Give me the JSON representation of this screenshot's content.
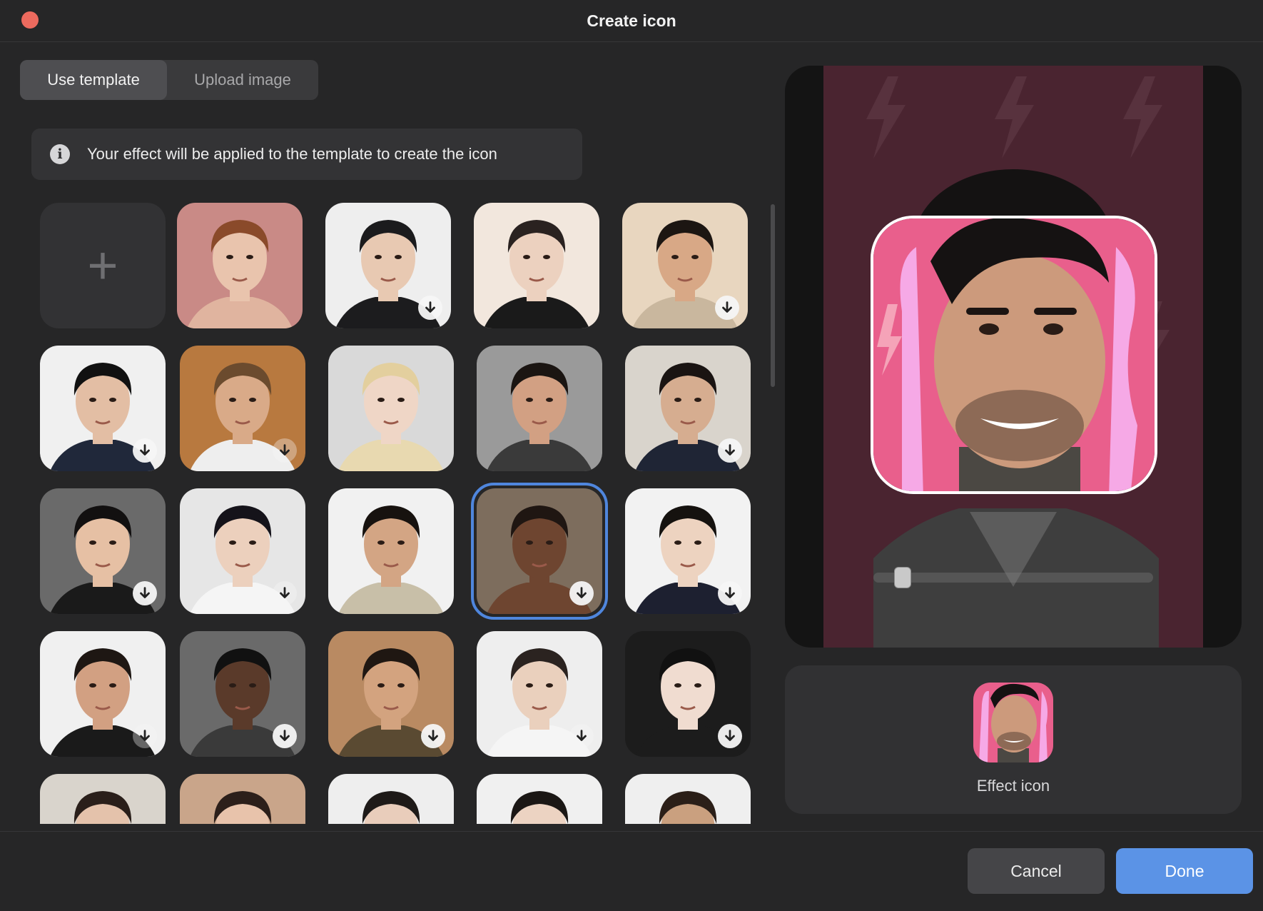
{
  "window": {
    "title": "Create icon"
  },
  "tabs": [
    {
      "label": "Use template",
      "active": true
    },
    {
      "label": "Upload image",
      "active": false
    }
  ],
  "info": {
    "text": "Your effect will be applied to the template to create the icon"
  },
  "templates": {
    "add_label": "+",
    "selected_index": 12,
    "items": [
      {
        "skin": "#e9c4ad",
        "hair": "#8a4a2a",
        "bg": "#c98a86",
        "shirt": "#e0b49f",
        "download": "none"
      },
      {
        "skin": "#e8c9b2",
        "hair": "#1b1b1d",
        "bg": "#eeeeee",
        "shirt": "#1c1c1e",
        "download": "solid"
      },
      {
        "skin": "#ecd1bf",
        "hair": "#2a2220",
        "bg": "#f2e7dd",
        "shirt": "#1a1a1a",
        "download": "none"
      },
      {
        "skin": "#d8a886",
        "hair": "#1c1612",
        "bg": "#e8d6bf",
        "shirt": "#c9b79e",
        "download": "solid"
      },
      {
        "skin": "#e3bea4",
        "hair": "#111111",
        "bg": "#f0f0f0",
        "shirt": "#20283a",
        "download": "solid"
      },
      {
        "skin": "#d9aa88",
        "hair": "#6b4b2e",
        "bg": "#b8793f",
        "shirt": "#eeeeee",
        "download": "faint"
      },
      {
        "skin": "#efd6c6",
        "hair": "#e3cf9e",
        "bg": "#d9d9d9",
        "shirt": "#e8d9b0",
        "download": "none"
      },
      {
        "skin": "#d2a083",
        "hair": "#1b1512",
        "bg": "#9a9a9a",
        "shirt": "#3a3a3a",
        "download": "none"
      },
      {
        "skin": "#d6ad90",
        "hair": "#1a1412",
        "bg": "#d9d4cc",
        "shirt": "#1f2535",
        "download": "solid"
      },
      {
        "skin": "#e6c0a4",
        "hair": "#121010",
        "bg": "#6a6a6a",
        "shirt": "#1a1a1a",
        "download": "solid"
      },
      {
        "skin": "#ecd0bd",
        "hair": "#15131a",
        "bg": "#e6e6e6",
        "shirt": "#f5f5f5",
        "download": "faint"
      },
      {
        "skin": "#d3a584",
        "hair": "#17120f",
        "bg": "#f1f1f1",
        "shirt": "#c8bfa8",
        "download": "none"
      },
      {
        "skin": "#6e4530",
        "hair": "#1f1612",
        "bg": "#7d6d5d",
        "shirt": "#6e4530",
        "download": "solid"
      },
      {
        "skin": "#edd3c0",
        "hair": "#15120f",
        "bg": "#f2f2f2",
        "shirt": "#1d2030",
        "download": "solid"
      },
      {
        "skin": "#d2a082",
        "hair": "#1e1713",
        "bg": "#f0f0f0",
        "shirt": "#1a1a1a",
        "download": "faint"
      },
      {
        "skin": "#5a3a2a",
        "hair": "#111111",
        "bg": "#6a6a6a",
        "shirt": "#3a3a3a",
        "download": "solid"
      },
      {
        "skin": "#d3a37f",
        "hair": "#1f1712",
        "bg": "#b98a62",
        "shirt": "#5a4a32",
        "download": "solid"
      },
      {
        "skin": "#ead0bd",
        "hair": "#2b2320",
        "bg": "#eeeeee",
        "shirt": "#f5f5f5",
        "download": "faint"
      },
      {
        "skin": "#f0dcd0",
        "hair": "#111111",
        "bg": "#1c1c1c",
        "shirt": "#1c1c1c",
        "download": "solid"
      },
      {
        "skin": "#e4c2ab",
        "hair": "#2a1f1a",
        "bg": "#d9d4cc",
        "shirt": "#333333",
        "download": "none"
      },
      {
        "skin": "#e8c3ab",
        "hair": "#2c1f1a",
        "bg": "#c9a58a",
        "shirt": "#333333",
        "download": "none"
      },
      {
        "skin": "#e9cdbb",
        "hair": "#1e1a18",
        "bg": "#eeeeee",
        "shirt": "#333333",
        "download": "none"
      },
      {
        "skin": "#ecd3c2",
        "hair": "#1b1715",
        "bg": "#f0f0f0",
        "shirt": "#333333",
        "download": "none"
      },
      {
        "skin": "#caa07f",
        "hair": "#2b1f18",
        "bg": "#efefef",
        "shirt": "#333333",
        "download": "none"
      }
    ]
  },
  "preview": {
    "background": "#4a2430",
    "effect_color": "#e95f8c",
    "outline_color": "#f6a9e6",
    "slider_value": 0.08
  },
  "effect_icon": {
    "label": "Effect icon"
  },
  "footer": {
    "cancel_label": "Cancel",
    "done_label": "Done"
  }
}
